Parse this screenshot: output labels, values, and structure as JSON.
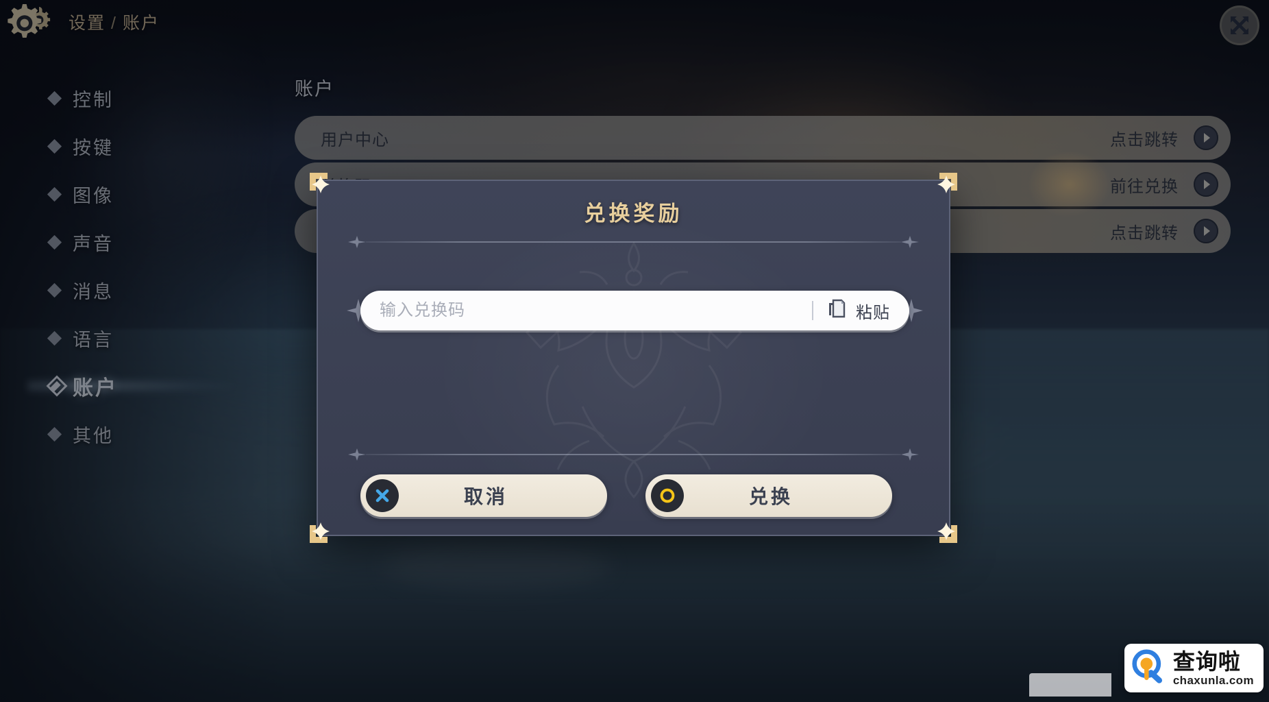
{
  "header": {
    "gear_icon": "gear-icon",
    "breadcrumb_root": "设置",
    "breadcrumb_separator": "/",
    "breadcrumb_current": "账户",
    "close_icon": "close-icon"
  },
  "sidebar": {
    "items": [
      {
        "label": "控制",
        "active": false
      },
      {
        "label": "按键",
        "active": false
      },
      {
        "label": "图像",
        "active": false
      },
      {
        "label": "声音",
        "active": false
      },
      {
        "label": "消息",
        "active": false
      },
      {
        "label": "语言",
        "active": false
      },
      {
        "label": "账户",
        "active": true
      },
      {
        "label": "其他",
        "active": false
      }
    ]
  },
  "content": {
    "section_title": "账户",
    "rows": [
      {
        "label": "用户中心",
        "action": "点击跳转"
      },
      {
        "label": "兑换码",
        "action": "前往兑换"
      },
      {
        "label": "",
        "action": "点击跳转"
      }
    ]
  },
  "dialog": {
    "title": "兑换奖励",
    "input": {
      "value": "",
      "placeholder": "输入兑换码",
      "paste_label": "粘贴",
      "paste_icon": "copy-icon"
    },
    "cancel": {
      "label": "取消",
      "icon": "cross-icon"
    },
    "confirm": {
      "label": "兑换",
      "icon": "ring-icon"
    }
  },
  "watermark": {
    "cn": "查询啦",
    "en": "chaxunla.com",
    "icon": "magnifier-icon"
  },
  "colors": {
    "gold": "#e8cf9d",
    "dialog_bg": "#3c4154",
    "button_cream": "#f2ece0",
    "accent_blue": "#45a8e8",
    "accent_yellow": "#f5c518",
    "row_bg": "#b2afa7",
    "text_dark": "#3b4150"
  }
}
